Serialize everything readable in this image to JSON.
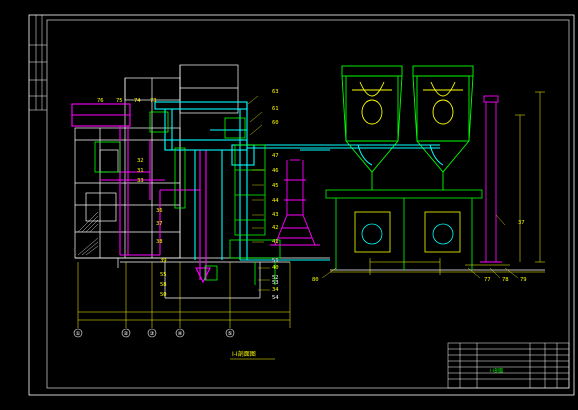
{
  "drawing": {
    "view_title": "Ⅰ-Ⅰ剖面图",
    "title_block": {
      "drawing_name": "",
      "section_label": "Ⅰ-Ⅰ剖面"
    },
    "colors": {
      "background": "#000000",
      "frame": "#ffffff",
      "equipment": "#00ff00",
      "duct": "#00ffff",
      "piping": "#ff00ff",
      "dimension": "#ffff00",
      "callout": "#ffff00"
    },
    "callouts_top": [
      "76",
      "75",
      "74",
      "73"
    ],
    "callouts_right": [
      "63",
      "61",
      "60",
      "47",
      "46",
      "45",
      "44",
      "43",
      "42",
      "41",
      "40",
      "34"
    ],
    "callouts_left": [
      "32",
      "31",
      "33",
      "36",
      "37",
      "38",
      "39",
      "55",
      "58",
      "50",
      "51",
      "52",
      "53",
      "54"
    ],
    "callouts_bottom": [
      "80",
      "77",
      "78",
      "79"
    ],
    "callout_side": "37",
    "axis_labels": [
      "①",
      "②",
      "③",
      "④",
      "⑤"
    ]
  }
}
